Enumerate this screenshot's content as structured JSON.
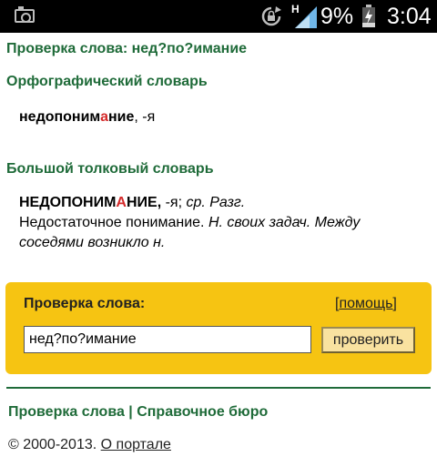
{
  "statusbar": {
    "network_label": "H",
    "battery_percent": "9%",
    "time": "3:04"
  },
  "page": {
    "title": "Проверка слова: нед?по?имание"
  },
  "orfo": {
    "title": "Орфографический словарь",
    "word_before_stress": "недопоним",
    "stressed_letter": "а",
    "word_after_stress": "ние",
    "ending": ", -я"
  },
  "tolk": {
    "title": "Большой толковый словарь",
    "head_before_stress": "НЕДОПОНИМ",
    "head_stressed": "А",
    "head_after_stress": "НИЕ,",
    "grammar": " -я; ",
    "notes": "ср. Разг.",
    "definition": "Недостаточное понимание. ",
    "examples": "Н. своих задач. Между соседями возникло н."
  },
  "checker": {
    "label": "Проверка слова:",
    "help_open": "[",
    "help_label": "помощь",
    "help_close": "]",
    "input_value": "нед?по?имание",
    "button_label": "проверить"
  },
  "footer": {
    "links": "Проверка слова | Справочное бюро",
    "copyright": "© 2000-2013. ",
    "about_label": "О портале"
  },
  "colors": {
    "accent_green": "#1f6b39",
    "panel_yellow": "#f6c412",
    "stress_red": "#d42a2a"
  }
}
